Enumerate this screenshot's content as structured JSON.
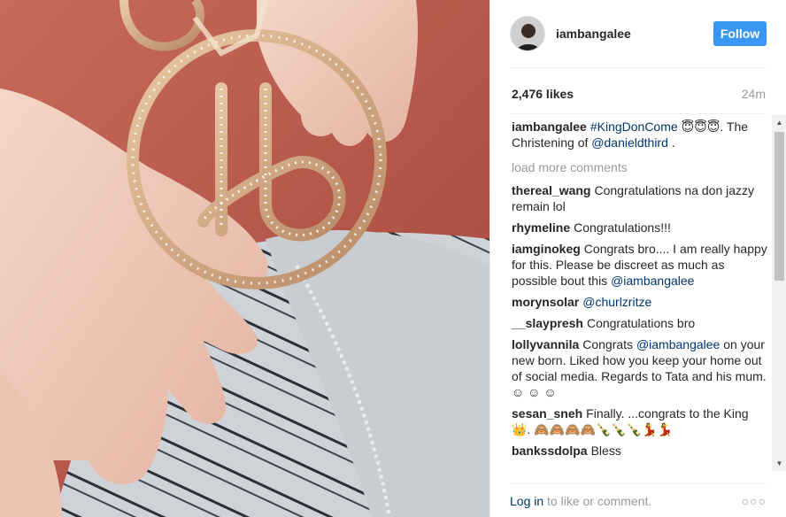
{
  "post": {
    "username": "iambangalee",
    "follow_label": "Follow",
    "likes": "2,476 likes",
    "time": "24m"
  },
  "caption": {
    "username": "iambangalee",
    "hashtag": "#KingDonCome",
    "emoji": "😇😇😇",
    "text_after_emoji": ". The Christening of",
    "mention": "@danieldthird",
    "end": " ."
  },
  "load_more": "load more comments",
  "comments": [
    {
      "user": "thereal_wang",
      "text": "Congratulations na don jazzy remain lol"
    },
    {
      "user": "rhymeline",
      "text": "Congratulations!!!"
    },
    {
      "user": "iamginokeg",
      "text": "Congrats bro.... I am really happy for this. Please be discreet as much as possible bout this",
      "mention": "@iambangalee"
    },
    {
      "user": "morynsolar",
      "mention": "@churlzritze"
    },
    {
      "user": "__slaypresh",
      "text": "Congratulations bro"
    },
    {
      "user": "lollyvannila",
      "text_before": "Congrats",
      "mention": "@iambangalee",
      "text": "on your new born. Liked how you keep your home out of social media. Regards to Tata and his mum. ☺ ☺ ☺"
    },
    {
      "user": "sesan_sneh",
      "text": "Finally. ...congrats to the King 👑. 🙈🙈🙈🙈🍾🍾🍾💃💃"
    },
    {
      "user": "bankssdolpa",
      "text": "Bless"
    }
  ],
  "footer": {
    "login": "Log in",
    "rest": "to like or comment.",
    "more": "○○○"
  },
  "colors": {
    "follow_bg": "#3897f0",
    "link": "#003569",
    "muted": "#999999"
  }
}
